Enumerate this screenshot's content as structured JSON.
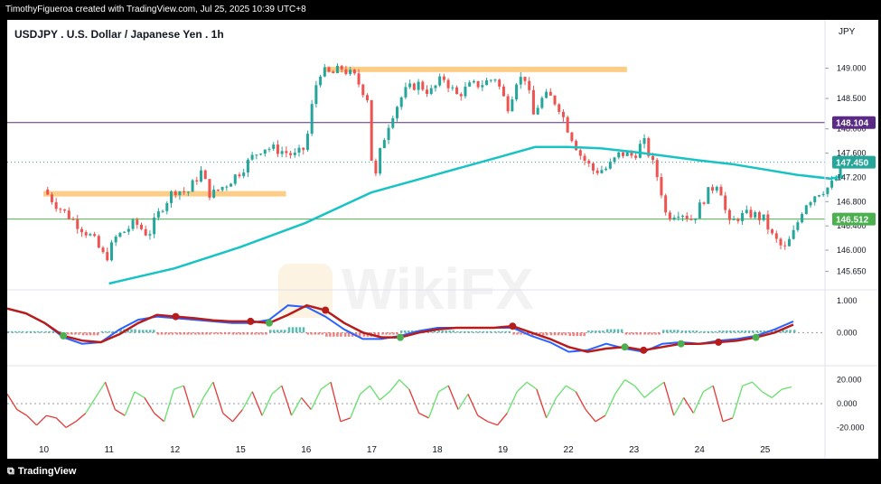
{
  "header": {
    "credit": "TimothyFigueroa created with TradingView.com, Jul 25, 2025 10:39 UTC+8"
  },
  "footer": {
    "brand": "TradingView"
  },
  "watermark": "WikiFX",
  "colors": {
    "up": "#26a69a",
    "down": "#ef5350",
    "ma": "#17c3c3",
    "support": "#fbc87a",
    "level_purple": "#5b2a86",
    "level_green": "#4caf50",
    "macd_fast": "#2962ff",
    "macd_slow": "#b71c1c",
    "macd_signal_up": "#4caf50",
    "osc_up": "#66e06a",
    "osc_down": "#e53935"
  },
  "chart_data": [
    {
      "type": "candlestick",
      "title": "USDJPY . U.S. Dollar / Japanese Yen . 1h",
      "currency": "JPY",
      "x_labels": [
        "10",
        "11",
        "12",
        "15",
        "16",
        "17",
        "18",
        "19",
        "22",
        "23",
        "24",
        "25"
      ],
      "y_ticks": [
        145.65,
        146.0,
        146.4,
        146.8,
        147.2,
        147.6,
        148.0,
        148.5,
        149.0
      ],
      "y_tick_labels": [
        "145.650",
        "146.000",
        "146.400",
        "146.800",
        "147.200",
        "147.600",
        "148.000",
        "148.500",
        "149.000"
      ],
      "ylim": [
        145.45,
        149.35
      ],
      "price_labels": [
        {
          "value": 148.104,
          "text": "148.104",
          "color": "#5b2a86"
        },
        {
          "value": 147.45,
          "text": "147.450",
          "color": "#26a69a"
        },
        {
          "value": 146.512,
          "text": "146.512",
          "color": "#4caf50"
        }
      ],
      "zones": [
        {
          "from_day": 0,
          "to_day": 3.7,
          "value": 146.93,
          "label": ""
        },
        {
          "from_day": 4.3,
          "to_day": 8.9,
          "value": 148.98,
          "label": ""
        }
      ],
      "close_series": [
        {
          "day": 0.0,
          "price": 147.0
        },
        {
          "day": 0.2,
          "price": 146.75
        },
        {
          "day": 0.45,
          "price": 146.5
        },
        {
          "day": 0.75,
          "price": 146.2
        },
        {
          "day": 0.95,
          "price": 145.85
        },
        {
          "day": 1.1,
          "price": 146.2
        },
        {
          "day": 1.4,
          "price": 146.45
        },
        {
          "day": 1.6,
          "price": 146.25
        },
        {
          "day": 1.8,
          "price": 146.7
        },
        {
          "day": 2.0,
          "price": 147.0
        },
        {
          "day": 2.2,
          "price": 146.95
        },
        {
          "day": 2.4,
          "price": 147.3
        },
        {
          "day": 2.55,
          "price": 146.9
        },
        {
          "day": 2.8,
          "price": 147.1
        },
        {
          "day": 3.0,
          "price": 147.3
        },
        {
          "day": 3.2,
          "price": 147.55
        },
        {
          "day": 3.35,
          "price": 147.7
        },
        {
          "day": 3.6,
          "price": 147.65
        },
        {
          "day": 3.85,
          "price": 147.55
        },
        {
          "day": 4.0,
          "price": 147.7
        },
        {
          "day": 4.1,
          "price": 148.4
        },
        {
          "day": 4.2,
          "price": 148.95
        },
        {
          "day": 4.4,
          "price": 148.9
        },
        {
          "day": 4.55,
          "price": 149.0
        },
        {
          "day": 4.75,
          "price": 148.85
        },
        {
          "day": 4.95,
          "price": 148.5
        },
        {
          "day": 5.0,
          "price": 147.55
        },
        {
          "day": 5.05,
          "price": 147.1
        },
        {
          "day": 5.15,
          "price": 147.7
        },
        {
          "day": 5.3,
          "price": 148.2
        },
        {
          "day": 5.5,
          "price": 148.6
        },
        {
          "day": 5.7,
          "price": 148.75
        },
        {
          "day": 5.9,
          "price": 148.6
        },
        {
          "day": 6.1,
          "price": 148.85
        },
        {
          "day": 6.3,
          "price": 148.55
        },
        {
          "day": 6.5,
          "price": 148.7
        },
        {
          "day": 6.7,
          "price": 148.75
        },
        {
          "day": 6.9,
          "price": 148.85
        },
        {
          "day": 7.0,
          "price": 148.55
        },
        {
          "day": 7.1,
          "price": 148.35
        },
        {
          "day": 7.2,
          "price": 148.8
        },
        {
          "day": 7.35,
          "price": 148.85
        },
        {
          "day": 7.5,
          "price": 148.1
        },
        {
          "day": 7.55,
          "price": 148.45
        },
        {
          "day": 7.7,
          "price": 148.55
        },
        {
          "day": 7.85,
          "price": 148.4
        },
        {
          "day": 8.0,
          "price": 148.0
        },
        {
          "day": 8.2,
          "price": 147.55
        },
        {
          "day": 8.4,
          "price": 147.3
        },
        {
          "day": 8.6,
          "price": 147.35
        },
        {
          "day": 8.8,
          "price": 147.6
        },
        {
          "day": 9.0,
          "price": 147.55
        },
        {
          "day": 9.15,
          "price": 147.8
        },
        {
          "day": 9.25,
          "price": 147.55
        },
        {
          "day": 9.4,
          "price": 147.1
        },
        {
          "day": 9.5,
          "price": 146.55
        },
        {
          "day": 9.7,
          "price": 146.65
        },
        {
          "day": 9.9,
          "price": 146.5
        },
        {
          "day": 10.1,
          "price": 146.9
        },
        {
          "day": 10.3,
          "price": 147.15
        },
        {
          "day": 10.45,
          "price": 146.4
        },
        {
          "day": 10.6,
          "price": 146.55
        },
        {
          "day": 10.8,
          "price": 146.6
        },
        {
          "day": 11.0,
          "price": 146.5
        },
        {
          "day": 11.1,
          "price": 146.25
        },
        {
          "day": 11.3,
          "price": 146.0
        },
        {
          "day": 11.45,
          "price": 146.3
        },
        {
          "day": 11.6,
          "price": 146.75
        },
        {
          "day": 11.8,
          "price": 146.95
        },
        {
          "day": 12.0,
          "price": 147.05
        },
        {
          "day": 12.1,
          "price": 147.2
        },
        {
          "day": 12.2,
          "price": 147.45
        }
      ],
      "ma_series": [
        {
          "day": 1.0,
          "price": 145.45
        },
        {
          "day": 2.0,
          "price": 145.7
        },
        {
          "day": 3.0,
          "price": 146.05
        },
        {
          "day": 4.0,
          "price": 146.45
        },
        {
          "day": 5.0,
          "price": 146.95
        },
        {
          "day": 6.0,
          "price": 147.25
        },
        {
          "day": 7.0,
          "price": 147.55
        },
        {
          "day": 7.5,
          "price": 147.7
        },
        {
          "day": 8.0,
          "price": 147.7
        },
        {
          "day": 8.5,
          "price": 147.68
        },
        {
          "day": 9.0,
          "price": 147.62
        },
        {
          "day": 9.5,
          "price": 147.55
        },
        {
          "day": 10.0,
          "price": 147.48
        },
        {
          "day": 10.5,
          "price": 147.42
        },
        {
          "day": 11.0,
          "price": 147.33
        },
        {
          "day": 11.5,
          "price": 147.24
        },
        {
          "day": 12.0,
          "price": 147.18
        },
        {
          "day": 12.2,
          "price": 147.22
        }
      ]
    },
    {
      "type": "line",
      "name": "MACD pane",
      "y_ticks": [
        1.0,
        0.0
      ],
      "y_tick_labels": [
        "1.000",
        "0.000"
      ],
      "ylim": [
        -0.95,
        1.25
      ],
      "series": [
        {
          "name": "",
          "values": [
            0.75,
            0.6,
            0.3,
            -0.15,
            -0.35,
            -0.3,
            0.1,
            0.4,
            0.5,
            0.45,
            0.4,
            0.35,
            0.3,
            0.3,
            0.4,
            0.85,
            0.8,
            0.5,
            0.1,
            -0.2,
            -0.2,
            -0.1,
            0.05,
            0.15,
            0.15,
            0.15,
            0.15,
            0.15,
            -0.1,
            -0.3,
            -0.6,
            -0.55,
            -0.35,
            -0.5,
            -0.6,
            -0.35,
            -0.3,
            -0.35,
            -0.25,
            -0.2,
            -0.1,
            0.1,
            0.35
          ]
        },
        {
          "name": "",
          "values": [
            0.75,
            0.6,
            0.3,
            -0.1,
            -0.25,
            -0.3,
            -0.05,
            0.3,
            0.55,
            0.5,
            0.45,
            0.38,
            0.35,
            0.35,
            0.3,
            0.55,
            0.85,
            0.7,
            0.3,
            0.0,
            -0.15,
            -0.15,
            0.0,
            0.1,
            0.15,
            0.15,
            0.15,
            0.2,
            0.0,
            -0.2,
            -0.45,
            -0.6,
            -0.5,
            -0.45,
            -0.55,
            -0.45,
            -0.35,
            -0.35,
            -0.3,
            -0.25,
            -0.15,
            0.0,
            0.25
          ]
        }
      ],
      "cross_markers": [
        {
          "index": 3,
          "kind": "bull"
        },
        {
          "index": 9,
          "kind": "bear"
        },
        {
          "index": 13,
          "kind": "bear"
        },
        {
          "index": 14,
          "kind": "bull"
        },
        {
          "index": 17,
          "kind": "bear"
        },
        {
          "index": 21,
          "kind": "bull"
        },
        {
          "index": 27,
          "kind": "bear"
        },
        {
          "index": 33,
          "kind": "bull"
        },
        {
          "index": 34,
          "kind": "bear"
        },
        {
          "index": 36,
          "kind": "bull"
        },
        {
          "index": 38,
          "kind": "bear"
        },
        {
          "index": 40,
          "kind": "bull"
        }
      ]
    },
    {
      "type": "line",
      "name": "oscillator pane",
      "y_ticks": [
        20.0,
        0.0,
        -20.0
      ],
      "y_tick_labels": [
        "20.000",
        "0.000",
        "-20.000"
      ],
      "ylim": [
        -28,
        28
      ],
      "series": [
        {
          "name": "",
          "values": [
            8,
            -5,
            -10,
            -18,
            -10,
            -12,
            -20,
            -15,
            -8,
            5,
            18,
            -5,
            -10,
            10,
            5,
            -8,
            -15,
            12,
            15,
            -12,
            5,
            18,
            -8,
            -15,
            -5,
            10,
            -10,
            8,
            15,
            -10,
            5,
            -5,
            12,
            18,
            -15,
            -12,
            8,
            15,
            3,
            10,
            20,
            12,
            -8,
            -12,
            10,
            15,
            -5,
            8,
            -10,
            -15,
            -18,
            -8,
            10,
            18,
            12,
            -12,
            5,
            15,
            10,
            -5,
            -15,
            -10,
            8,
            20,
            15,
            5,
            12,
            18,
            -10,
            5,
            -8,
            10,
            15,
            -15,
            -12,
            15,
            18,
            10,
            5,
            12,
            14
          ]
        }
      ]
    }
  ]
}
